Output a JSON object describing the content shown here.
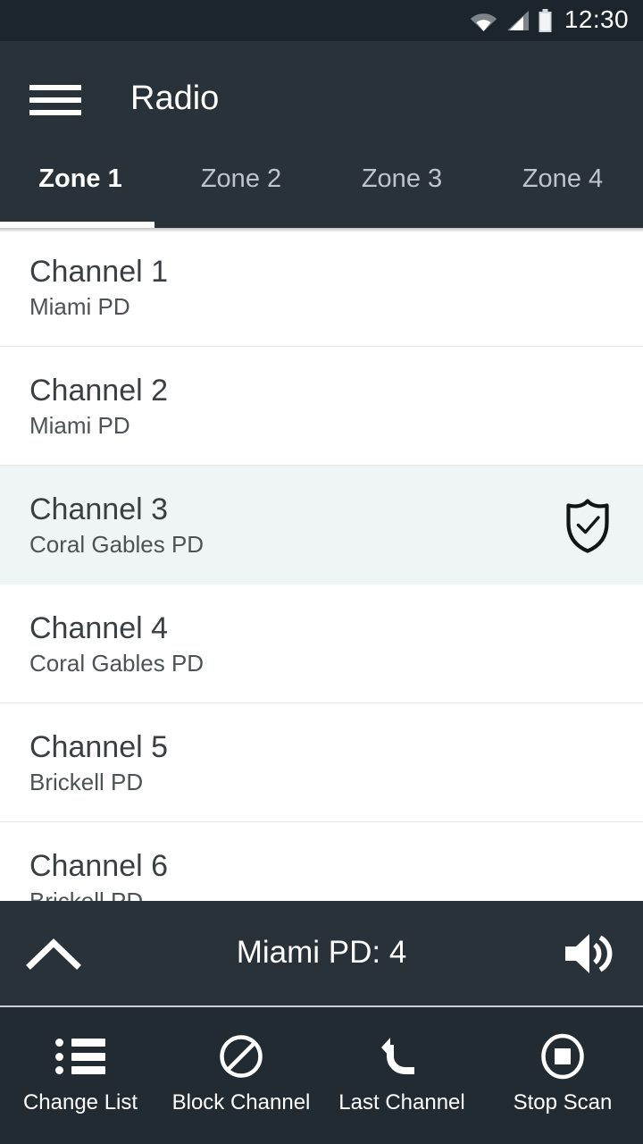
{
  "status_bar": {
    "time": "12:30",
    "icons": [
      "wifi-icon",
      "cellular-signal-icon",
      "battery-icon"
    ]
  },
  "header": {
    "menu_icon": "hamburger-menu-icon",
    "title": "Radio",
    "tabs": [
      {
        "label": "Zone 1",
        "active": true
      },
      {
        "label": "Zone 2",
        "active": false
      },
      {
        "label": "Zone 3",
        "active": false
      },
      {
        "label": "Zone 4",
        "active": false
      }
    ]
  },
  "channel_list": {
    "rows": [
      {
        "title": "Channel 1",
        "subtitle": "Miami PD",
        "selected": false,
        "badge": null
      },
      {
        "title": "Channel 2",
        "subtitle": "Miami PD",
        "selected": false,
        "badge": null
      },
      {
        "title": "Channel 3",
        "subtitle": "Coral Gables PD",
        "selected": true,
        "badge": "shield-check-icon"
      },
      {
        "title": "Channel 4",
        "subtitle": "Coral Gables PD",
        "selected": false,
        "badge": null
      },
      {
        "title": "Channel 5",
        "subtitle": "Brickell PD",
        "selected": false,
        "badge": null
      },
      {
        "title": "Channel 6",
        "subtitle": "Brickell PD",
        "selected": false,
        "badge": null
      }
    ]
  },
  "player": {
    "expand_icon": "chevron-up-icon",
    "now_playing": "Miami PD: 4",
    "volume_icon": "volume-up-icon"
  },
  "action_bar": {
    "actions": [
      {
        "label": "Change List",
        "icon": "bulleted-list-icon"
      },
      {
        "label": "Block Channel",
        "icon": "block-circle-slash-icon"
      },
      {
        "label": "Last Channel",
        "icon": "undo-arrow-icon"
      },
      {
        "label": "Stop Scan",
        "icon": "stop-circle-icon"
      }
    ]
  },
  "colors": {
    "status_bar_bg": "#1c252b",
    "header_bg": "#293238",
    "action_bar_bg": "#222b31",
    "selected_row_bg": "#eff5f7",
    "list_bg": "#ffffff",
    "accent_indicator": "#ffffff",
    "primary_text": "#3b3f42",
    "secondary_text": "#4d5255",
    "tab_inactive_text": "#bdc5ca"
  }
}
